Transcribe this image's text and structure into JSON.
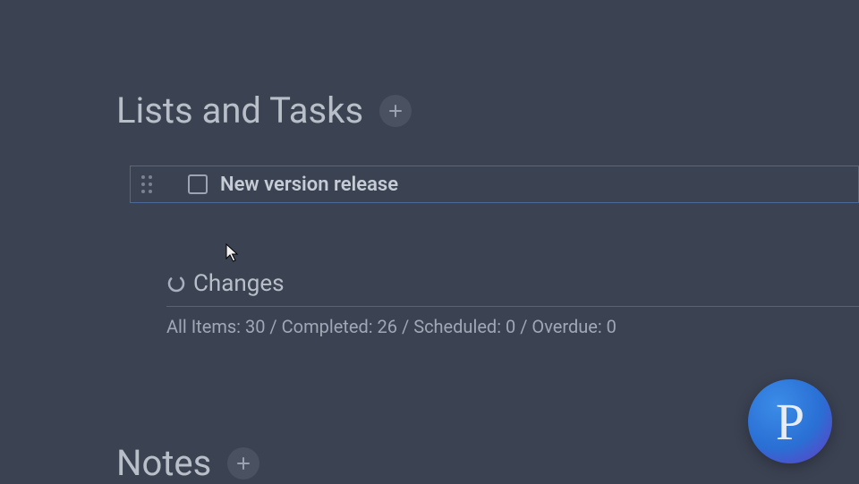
{
  "sections": {
    "lists": {
      "title": "Lists and Tasks"
    },
    "notes": {
      "title": "Notes"
    }
  },
  "task": {
    "title": "New version release",
    "completed": false
  },
  "sublist": {
    "title": "Changes",
    "stats_text": "All Items: 30 / Completed: 26 / Scheduled: 0 / Overdue: 0",
    "all_items": 30,
    "completed": 26,
    "scheduled": 0,
    "overdue": 0
  },
  "logo": {
    "letter": "P"
  }
}
